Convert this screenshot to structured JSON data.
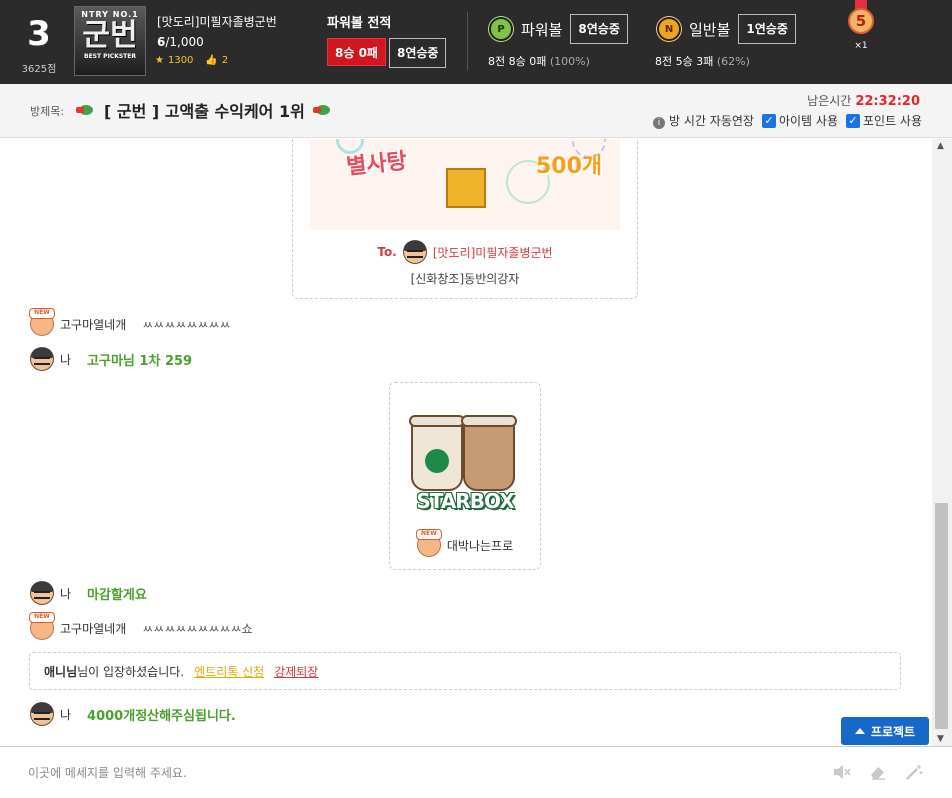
{
  "header": {
    "rank": "3",
    "rank_points": "3625점",
    "profile": {
      "badge_top": "NTRY NO.1",
      "badge_main": "군번",
      "badge_bottom": "BEST PICKSTER"
    },
    "username": "[맛도리]미필자졸병군번",
    "count_current": "6",
    "count_total": "/1,000",
    "stars": "1300",
    "likes": "2",
    "powerball_record": {
      "title": "파워볼 전적",
      "record": "8승 0패",
      "streak": "8연승중"
    },
    "powerball": {
      "icon_letter": "P",
      "name": "파워볼",
      "streak": "8연승중",
      "stat": "8전 8승 0패",
      "pct": "(100%)"
    },
    "normalball": {
      "icon_letter": "N",
      "name": "일반볼",
      "streak": "1연승중",
      "stat": "8전 5승 3패",
      "pct": "(62%)"
    },
    "medal": {
      "number": "5",
      "count": "×1"
    }
  },
  "room": {
    "label": "방제목:",
    "title": "[ 군번 ] 고액출 수익케어 1위",
    "remaining_label": "남은시간",
    "remaining_time": "22:32:20",
    "options": {
      "auto_extend": "방 시간 자동연장",
      "item_use": "아이템 사용",
      "point_use": "포인트 사용"
    }
  },
  "chat": {
    "gift1": {
      "image_text_left": "별사탕",
      "image_text_right": "500개",
      "to_prefix": "To.",
      "to_user": "[맛도리]미필자졸병군번",
      "from_user": "[신화창조]동반의강자"
    },
    "gift2": {
      "brand": "STARBOX",
      "from_user": "대박나는프로"
    },
    "messages": [
      {
        "avatar": "new",
        "nick": "고구마열네개",
        "text": "ㅆㅆㅆㅆㅆㅆㅆㅆ",
        "me": false
      },
      {
        "avatar": "me",
        "nick": "나",
        "text": "고구마님 1차 259",
        "me": true
      },
      {
        "avatar": "me",
        "nick": "나",
        "text": "마감할게요",
        "me": true
      },
      {
        "avatar": "new",
        "nick": "고구마열네개",
        "text": "ㅆㅆㅆㅆㅆㅆㅆㅆㅆ쇼",
        "me": false
      },
      {
        "avatar": "me",
        "nick": "나",
        "text": "4000개정산해주심됩니다.",
        "me": true
      }
    ],
    "notice": {
      "user": "애니님",
      "text": "님이 입장하셨습니다.",
      "link_entry": "엔트리톡 신청",
      "link_kick": "강제퇴장"
    },
    "protect_button": "프로젝트"
  },
  "input": {
    "placeholder": "이곳에 메세지를 입력해 주세요."
  }
}
